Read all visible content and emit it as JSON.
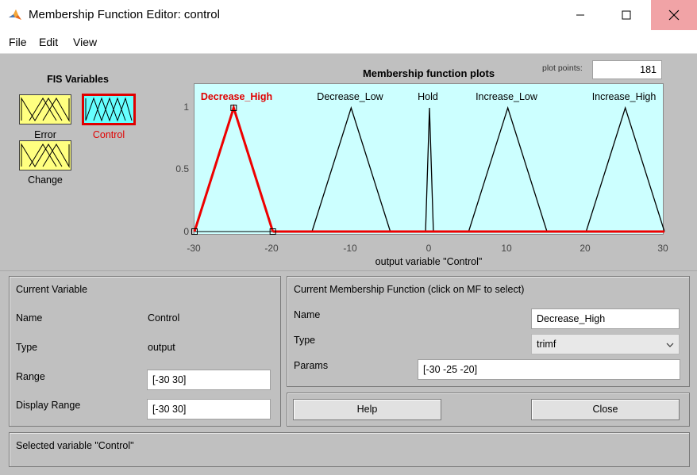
{
  "window": {
    "title": "Membership Function Editor: control"
  },
  "menu": {
    "file": "File",
    "edit": "Edit",
    "view": "View"
  },
  "fis_variables": {
    "title": "FIS Variables",
    "items": [
      {
        "label": "Error",
        "selected": false
      },
      {
        "label": "Control",
        "selected": true
      },
      {
        "label": "Change",
        "selected": false
      }
    ]
  },
  "plot": {
    "title": "Membership function plots",
    "plot_points_label": "plot points:",
    "plot_points_value": "181",
    "x_axis_label": "output variable \"Control\"",
    "x_ticks": [
      "-30",
      "-20",
      "-10",
      "0",
      "10",
      "20",
      "30"
    ],
    "y_ticks": [
      "1",
      "0.5",
      "0"
    ],
    "x_range": [
      -30,
      30
    ],
    "y_range": [
      0,
      1
    ],
    "background_color": "#ccffff",
    "selected_color": "#ee0000",
    "mfs": [
      {
        "name": "Decrease_High",
        "params": [
          -30,
          -25,
          -20
        ],
        "selected": true
      },
      {
        "name": "Decrease_Low",
        "params": [
          -15,
          -10,
          -5
        ],
        "selected": false
      },
      {
        "name": "Hold",
        "params": [
          -0.5,
          0,
          0.5
        ],
        "selected": false
      },
      {
        "name": "Increase_Low",
        "params": [
          5,
          10,
          15
        ],
        "selected": false
      },
      {
        "name": "Increase_High",
        "params": [
          20,
          25,
          30
        ],
        "selected": false
      }
    ]
  },
  "current_variable": {
    "title": "Current Variable",
    "name_label": "Name",
    "name_value": "Control",
    "type_label": "Type",
    "type_value": "output",
    "range_label": "Range",
    "range_value": "[-30 30]",
    "display_range_label": "Display Range",
    "display_range_value": "[-30 30]"
  },
  "current_mf": {
    "title": "Current Membership Function (click on MF to select)",
    "name_label": "Name",
    "name_value": "Decrease_High",
    "type_label": "Type",
    "type_value": "trimf",
    "params_label": "Params",
    "params_value": "[-30 -25 -20]"
  },
  "buttons": {
    "help": "Help",
    "close": "Close"
  },
  "status": {
    "text": "Selected variable \"Control\""
  }
}
